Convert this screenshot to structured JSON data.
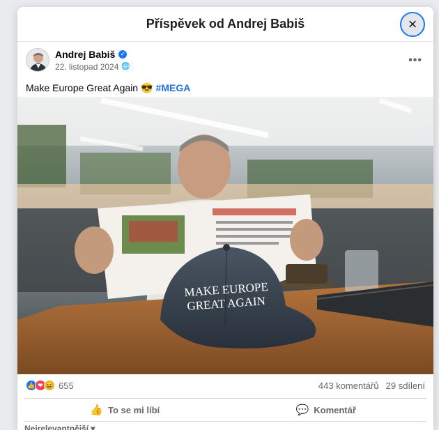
{
  "modal": {
    "title": "Příspěvek od Andrej Babiš",
    "close_icon": "×"
  },
  "post": {
    "author": "Andrej Babiš",
    "date": "22. listopad 2024",
    "verified_icon": "✓",
    "globe_icon": "🌐",
    "more_label": "•••",
    "text": "Make Europe Great Again",
    "emoji": "😎",
    "hashtag": "#MEGA",
    "photo": {
      "cap_text_line1": "MAKE EUROPE",
      "cap_text_line2": "GREAT AGAIN"
    }
  },
  "stats": {
    "reaction_like": "👍",
    "reaction_love": "❤",
    "reaction_haha": "😆",
    "reactions": "655",
    "comments": "443 komentářů",
    "shares": "29 sdílení"
  },
  "actions": {
    "like_icon": "👍",
    "like_label": "To se mi líbí",
    "comment_icon": "💬",
    "comment_label": "Komentář"
  },
  "sort": {
    "label": "Nejrelevantnější ▾"
  }
}
